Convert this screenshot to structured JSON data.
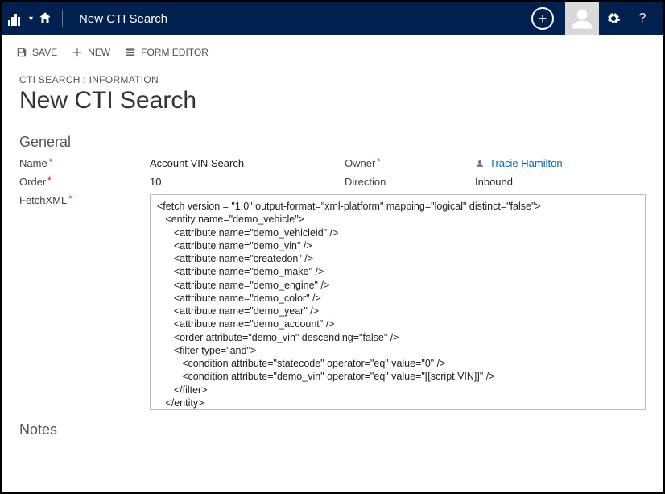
{
  "topbar": {
    "page_title": "New CTI Search"
  },
  "cmdbar": {
    "save": "SAVE",
    "new": "NEW",
    "form_editor": "FORM EDITOR"
  },
  "breadcrumb": "CTI SEARCH : INFORMATION",
  "record_title": "New CTI Search",
  "sections": {
    "general": "General",
    "notes": "Notes"
  },
  "fields": {
    "name_label": "Name",
    "name_value": "Account VIN Search",
    "order_label": "Order",
    "order_value": "10",
    "owner_label": "Owner",
    "owner_value": "Tracie Hamilton",
    "direction_label": "Direction",
    "direction_value": "Inbound",
    "fetch_label": "FetchXML"
  },
  "fetchxml": "<fetch version = \"1.0\" output-format=\"xml-platform\" mapping=\"logical\" distinct=\"false\">\n   <entity name=\"demo_vehicle\">\n      <attribute name=\"demo_vehicleid\" />\n      <attribute name=\"demo_vin\" />\n      <attribute name=\"createdon\" />\n      <attribute name=\"demo_make\" />\n      <attribute name=\"demo_engine\" />\n      <attribute name=\"demo_color\" />\n      <attribute name=\"demo_year\" />\n      <attribute name=\"demo_account\" />\n      <order attribute=\"demo_vin\" descending=\"false\" />\n      <filter type=\"and\">\n         <condition attribute=\"statecode\" operator=\"eq\" value=\"0\" />\n         <condition attribute=\"demo_vin\" operator=\"eq\" value=\"[[script.VIN]]\" />\n      </filter>\n   </entity>\n</fetch>"
}
